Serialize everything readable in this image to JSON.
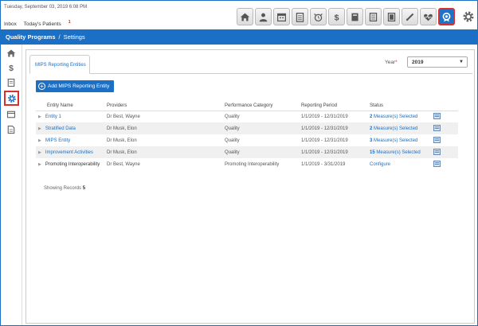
{
  "header": {
    "date": "Tuesday, September 03, 2019 6:08 PM",
    "inbox_label": "Inbox",
    "patients_label": "Today's Patients",
    "patients_count": "1"
  },
  "toolbar": {
    "icons": [
      "home-icon",
      "person-icon",
      "calendar-icon",
      "clipboard-icon",
      "alarm-icon",
      "dollar-icon",
      "book-icon",
      "document-icon",
      "film-icon",
      "pen-icon",
      "heart-icon",
      "badge-icon",
      "gear-icon"
    ],
    "active": "badge-icon"
  },
  "nav": {
    "section": "Quality Programs",
    "page": "Settings"
  },
  "sidebar": {
    "icons": [
      "home-icon",
      "dollar-icon",
      "notepad-icon",
      "gear-icon",
      "card-icon",
      "doc-icon"
    ],
    "active": "gear-icon"
  },
  "tab": {
    "label": "MIPS Reporting Entities"
  },
  "year": {
    "label": "Year",
    "required": "*",
    "value": "2019"
  },
  "add_button": {
    "label": "Add MIPS Reporting Entity"
  },
  "table": {
    "headers": [
      "Entity Name",
      "Providers",
      "Performance Category",
      "Reporting Period",
      "Status"
    ],
    "rows": [
      {
        "name": "Entity 1",
        "providers": "Dr Best, Wayne",
        "category": "Quality",
        "period": "1/1/2019 - 12/31/2019",
        "status_count": "2",
        "status_text": " Measure(s) Selected"
      },
      {
        "name": "Stratified Data",
        "providers": "Dr Musk, Elon",
        "category": "Quality",
        "period": "1/1/2019 - 12/31/2019",
        "status_count": "2",
        "status_text": " Measure(s) Selected"
      },
      {
        "name": "MIPS Entity",
        "providers": "Dr Musk, Elon",
        "category": "Quality",
        "period": "1/1/2019 - 12/31/2019",
        "status_count": "3",
        "status_text": " Measure(s) Selected"
      },
      {
        "name": "Improvement Activities",
        "providers": "Dr Musk, Elon",
        "category": "Quality",
        "period": "1/1/2019 - 12/31/2019",
        "status_count": "15",
        "status_text": " Measure(s) Selected"
      },
      {
        "name": "Promoting Interoperability",
        "providers": "Dr Best, Wayne",
        "category": "Promoting Interoperability",
        "period": "1/1/2019 - 3/31/2019",
        "status_count": "",
        "status_text": "Configure"
      }
    ]
  },
  "records": {
    "label": "Showing Records",
    "count": "5"
  },
  "colors": {
    "primary": "#1b6fc4",
    "highlight": "#d9302b"
  }
}
